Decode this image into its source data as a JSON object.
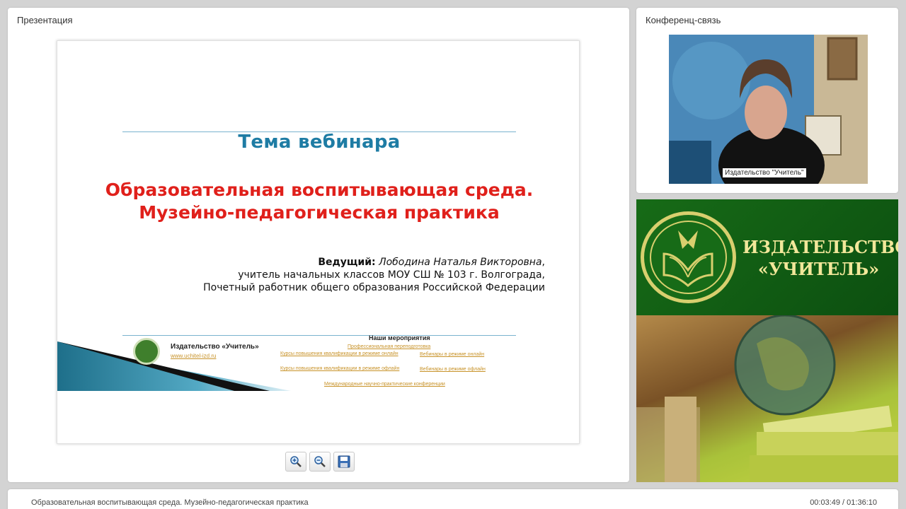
{
  "presentation_panel": {
    "title": "Презентация",
    "slide": {
      "topic": "Тема вебинара",
      "title_line1": "Образовательная воспитывающая среда.",
      "title_line2": "Музейно-педагогическая практика",
      "presenter_label": "Ведущий:",
      "presenter_name": "Лободина Наталья Викторовна",
      "presenter_line2": "учитель начальных классов МОУ СШ № 103 г. Волгограда,",
      "presenter_line3": "Почетный работник общего образования Российской Федерации",
      "footer": {
        "publisher": "Издательство «Учитель»",
        "url": "www.uchitel-izd.ru",
        "events_title": "Наши мероприятия",
        "events": [
          "Профессиональная переподготовка",
          "Курсы повышения квалификации в режиме онлайн",
          "Вебинары в режиме онлайн",
          "Курсы повышения квалификации в режиме офлайн",
          "Вебинары в режиме офлайн",
          "Международные научно-практические конференции"
        ]
      }
    },
    "tools": {
      "zoom_in": "zoom-in-icon",
      "zoom_out": "zoom-out-icon",
      "save": "save-icon"
    }
  },
  "conference_panel": {
    "title": "Конференц-связь",
    "video_label": "Издательство \"Учитель\""
  },
  "banner": {
    "line1": "ИЗДАТЕЛЬСТВО",
    "line2": "«УЧИТЕЛЬ»"
  },
  "bottom_bar": {
    "title": "Образовательная воспитывающая среда. Музейно-педагогическая практика",
    "time": "00:03:49 / 01:36:10"
  },
  "colors": {
    "accent_blue": "#1e7ca4",
    "title_red": "#e0201b",
    "banner_green": "#176b17",
    "banner_gold": "#f2e79a"
  }
}
